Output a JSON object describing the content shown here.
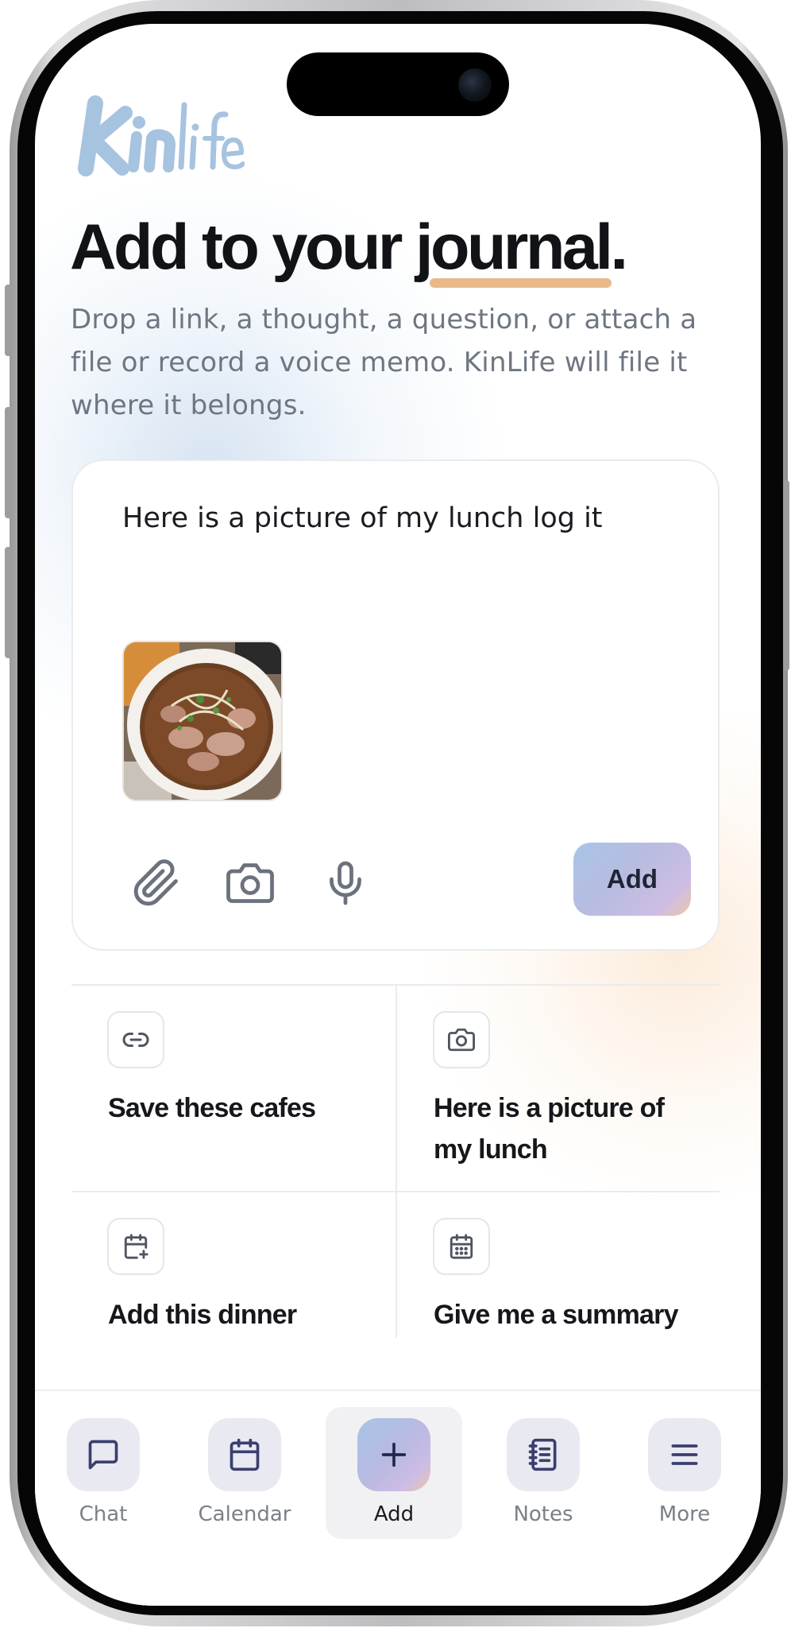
{
  "app": {
    "name": "KinLife",
    "logo_text": "kinlife"
  },
  "header": {
    "headline_prefix": "Add to your",
    "headline_highlight": "journal",
    "headline_suffix": ".",
    "subtitle": "Drop a link, a thought, a question, or attach a file or record a voice memo. KinLife will file it where it belongs."
  },
  "composer": {
    "text": "Here is a picture of my lunch log it",
    "attachment": {
      "type": "image",
      "description_icon": "food-photo-thumbnail"
    },
    "tools": [
      {
        "name": "attach",
        "icon": "paperclip-icon"
      },
      {
        "name": "camera",
        "icon": "camera-icon"
      },
      {
        "name": "voice",
        "icon": "microphone-icon"
      }
    ],
    "submit_label": "Add"
  },
  "suggestions": [
    {
      "icon": "link-icon",
      "label": "Save these cafes"
    },
    {
      "icon": "camera-icon",
      "label": "Here is a picture of my lunch"
    },
    {
      "icon": "calendar-plus-icon",
      "label": "Add this dinner"
    },
    {
      "icon": "calendar-grid-icon",
      "label": "Give me a summary"
    }
  ],
  "nav": {
    "active": "Add",
    "items": [
      {
        "label": "Chat",
        "icon": "chat-bubble-icon"
      },
      {
        "label": "Calendar",
        "icon": "calendar-icon"
      },
      {
        "label": "Add",
        "icon": "plus-icon"
      },
      {
        "label": "Notes",
        "icon": "notebook-icon"
      },
      {
        "label": "More",
        "icon": "hamburger-menu-icon"
      }
    ]
  },
  "colors": {
    "accent_underline": "#e8b98a",
    "logo_blue": "#a6c3df",
    "gradient_start": "#a8c4e6",
    "gradient_end": "#ecc7a6",
    "text_primary": "#111317",
    "text_muted": "#6e7682"
  }
}
